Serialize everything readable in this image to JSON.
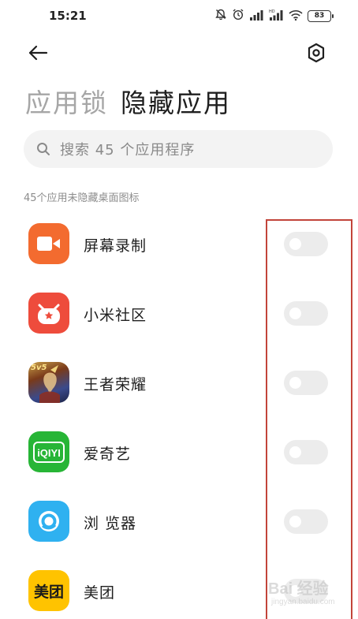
{
  "status_bar": {
    "time": "15:21",
    "battery": "83",
    "icons": [
      "alarm-off-icon",
      "alarm-clock-icon",
      "signal-icon",
      "hd-signal-icon",
      "wifi-icon",
      "battery-icon"
    ]
  },
  "header": {
    "back_icon": "arrow-left-icon",
    "settings_icon": "gear-icon"
  },
  "tabs": [
    {
      "label": "应用锁",
      "active": false
    },
    {
      "label": "隐藏应用",
      "active": true
    }
  ],
  "search": {
    "placeholder": "搜索 45 个应用程序",
    "icon": "search-icon"
  },
  "section_label": "45个应用未隐藏桌面图标",
  "apps": [
    {
      "name": "屏幕录制",
      "icon": "screen-recorder-icon",
      "icon_color": "#f36b2f",
      "hidden": false
    },
    {
      "name": "小米社区",
      "icon": "mi-community-icon",
      "icon_color": "#ee4c3c",
      "hidden": false
    },
    {
      "name": "王者荣耀",
      "icon": "honor-of-kings-icon",
      "icon_color": "#3a4a8c",
      "hidden": false
    },
    {
      "name": "爱奇艺",
      "icon": "iqiyi-icon",
      "icon_color": "#27b536",
      "hidden": false
    },
    {
      "name": "浏 览器",
      "icon": "browser-icon",
      "icon_color": "#2fb1f0",
      "hidden": false
    },
    {
      "name": "美团",
      "icon": "meituan-icon",
      "icon_color": "#ffc300",
      "hidden": false
    }
  ],
  "icon_labels": {
    "iqiyi": "iQIYI",
    "meituan": "美团",
    "game_badge": "5v5"
  },
  "watermark": {
    "text": "Bai 经验",
    "url": "jingyan.baidu.com"
  },
  "colors": {
    "highlight_border": "#c2443a",
    "toggle_off": "#ececec",
    "tab_inactive": "#a6a6a6"
  }
}
